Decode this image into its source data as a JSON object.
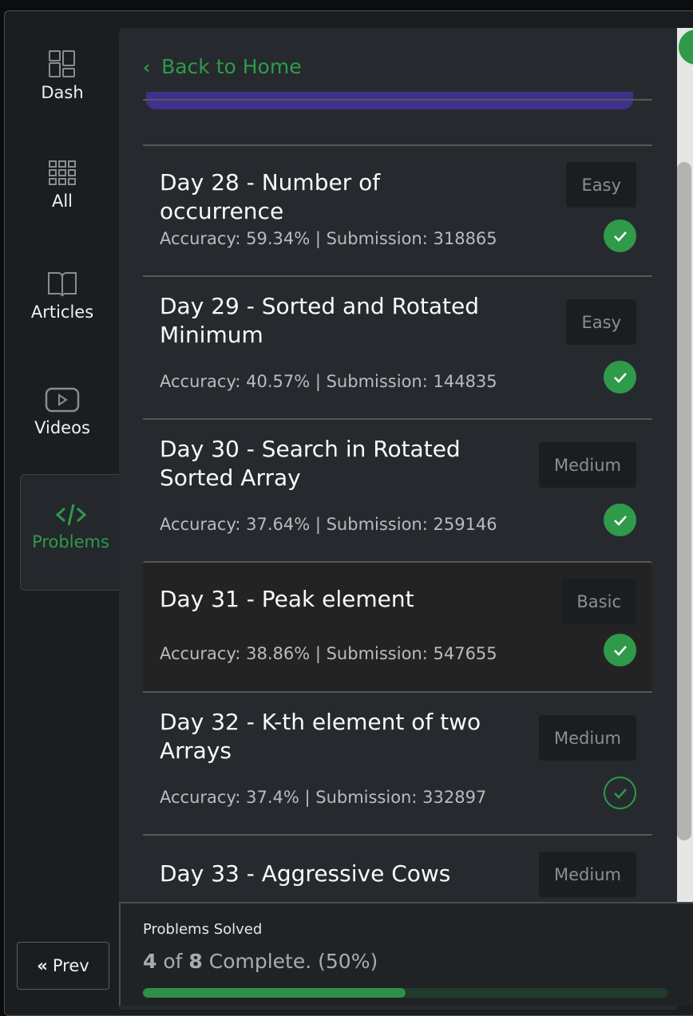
{
  "sidebar": {
    "items": [
      {
        "label": "Dash",
        "icon": "dashboard-icon"
      },
      {
        "label": "All",
        "icon": "grid-icon"
      },
      {
        "label": "Articles",
        "icon": "book-icon"
      },
      {
        "label": "Videos",
        "icon": "video-icon"
      },
      {
        "label": "Problems",
        "icon": "code-icon",
        "active": true
      }
    ],
    "prev_label": "Prev"
  },
  "header": {
    "back_label": "Back to Home"
  },
  "problems": [
    {
      "title": "Day 28 - Number of occurrence",
      "accuracy": "Accuracy: 59.34% | Submission: 318865",
      "difficulty": "Easy",
      "solved": true
    },
    {
      "title": "Day 29 - Sorted and Rotated Minimum",
      "accuracy": "Accuracy: 40.57% | Submission: 144835",
      "difficulty": "Easy",
      "solved": true
    },
    {
      "title": "Day 30 - Search in Rotated Sorted Array",
      "accuracy": "Accuracy: 37.64% | Submission: 259146",
      "difficulty": "Medium",
      "solved": true
    },
    {
      "title": "Day 31 - Peak element",
      "accuracy": "Accuracy: 38.86% | Submission: 547655",
      "difficulty": "Basic",
      "solved": true
    },
    {
      "title": "Day 32 - K-th element of two Arrays",
      "accuracy": "Accuracy: 37.4% | Submission: 332897",
      "difficulty": "Medium",
      "solved": false
    },
    {
      "title": "Day 33 - Aggressive Cows",
      "difficulty": "Medium"
    }
  ],
  "footer": {
    "label": "Problems Solved",
    "solved": "4",
    "of": " of ",
    "total": "8",
    "suffix": " Complete. (50%)",
    "progress_percent": 50
  },
  "colors": {
    "accent": "#2f9a4a",
    "purple": "#40318c"
  }
}
